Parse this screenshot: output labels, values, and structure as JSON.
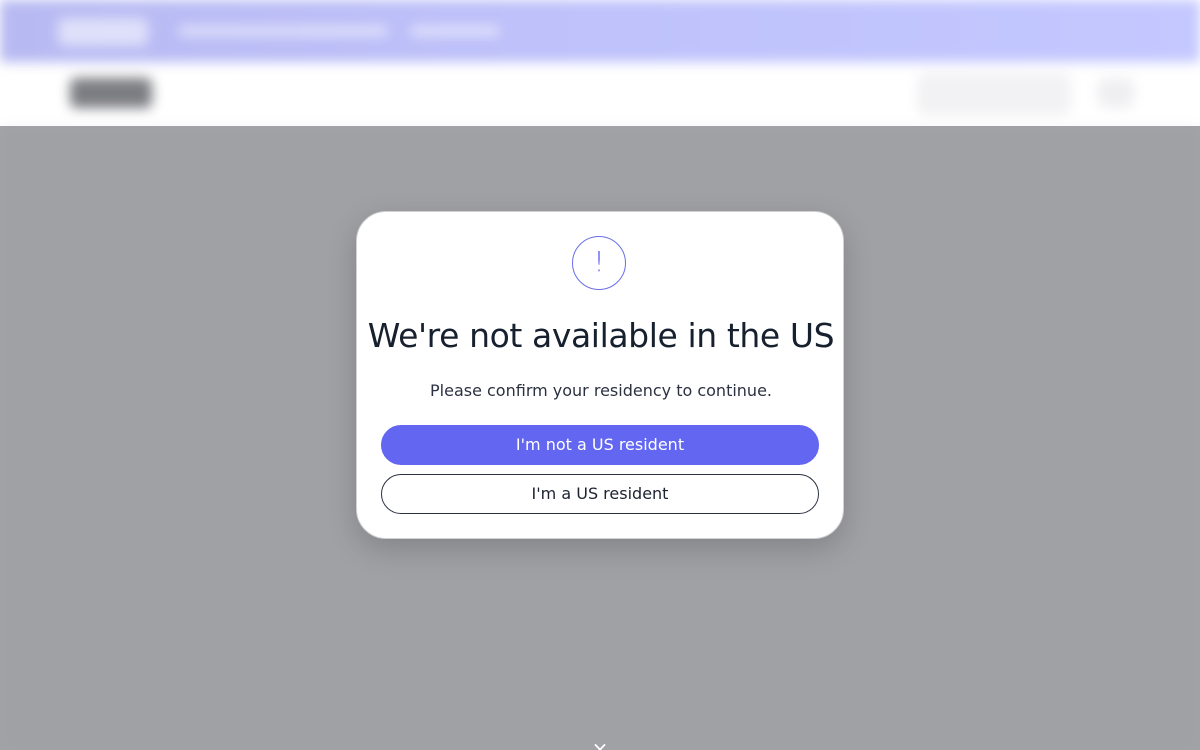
{
  "modal": {
    "icon": "exclamation-circle-icon",
    "icon_glyph": "!",
    "title": "We're not available in the US",
    "subtitle": "Please confirm your residency to continue.",
    "primary_button_label": "I'm not a US resident",
    "secondary_button_label": "I'm a US resident"
  },
  "colors": {
    "accent": "#6366f1",
    "title": "#17202e",
    "overlay": "#78797d",
    "promo_bar": "#bfc2fb"
  },
  "close": {
    "icon": "close-icon",
    "glyph": "×"
  }
}
